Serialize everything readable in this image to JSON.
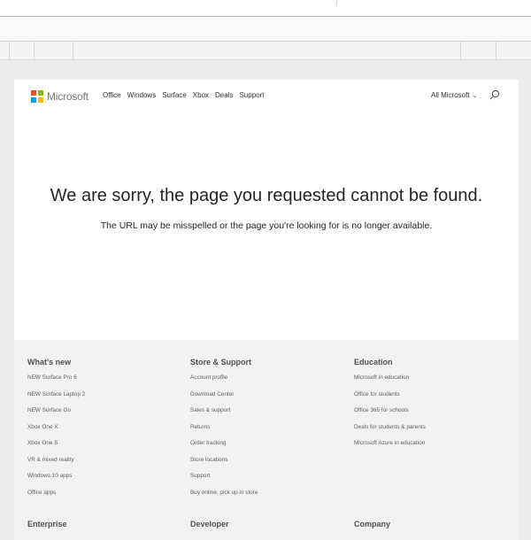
{
  "colors": {
    "ms_red": "#f25022",
    "ms_green": "#7fba00",
    "ms_blue": "#00a4ef",
    "ms_yellow": "#ffb900",
    "footer_bg": "#f2f2f2"
  },
  "header": {
    "logo_text": "Microsoft",
    "nav": [
      "Office",
      "Windows",
      "Surface",
      "Xbox",
      "Deals",
      "Support"
    ],
    "all_microsoft": "All Microsoft",
    "chevron": "⌄",
    "search_icon": "search-icon"
  },
  "error": {
    "title": "We are sorry, the page you requested cannot be found.",
    "subtitle": "The URL may be misspelled or the page you're looking for is no longer available."
  },
  "footer": {
    "columns": [
      {
        "heading": "What's new",
        "links": [
          "NEW Surface Pro 6",
          "NEW Surface Laptop 2",
          "NEW Surface Go",
          "Xbox One X",
          "Xbox One S",
          "VR & mixed reality",
          "Windows 10 apps",
          "Office apps"
        ]
      },
      {
        "heading": "Store & Support",
        "links": [
          "Account profile",
          "Download Center",
          "Sales & support",
          "Returns",
          "Order tracking",
          "Store locations",
          "Support",
          "Buy online, pick up in store"
        ]
      },
      {
        "heading": "Education",
        "links": [
          "Microsoft in education",
          "Office for students",
          "Office 365 for schools",
          "Deals for students & parents",
          "Microsoft Azure in education"
        ]
      }
    ],
    "next_headings": [
      "Enterprise",
      "Developer",
      "Company"
    ]
  }
}
